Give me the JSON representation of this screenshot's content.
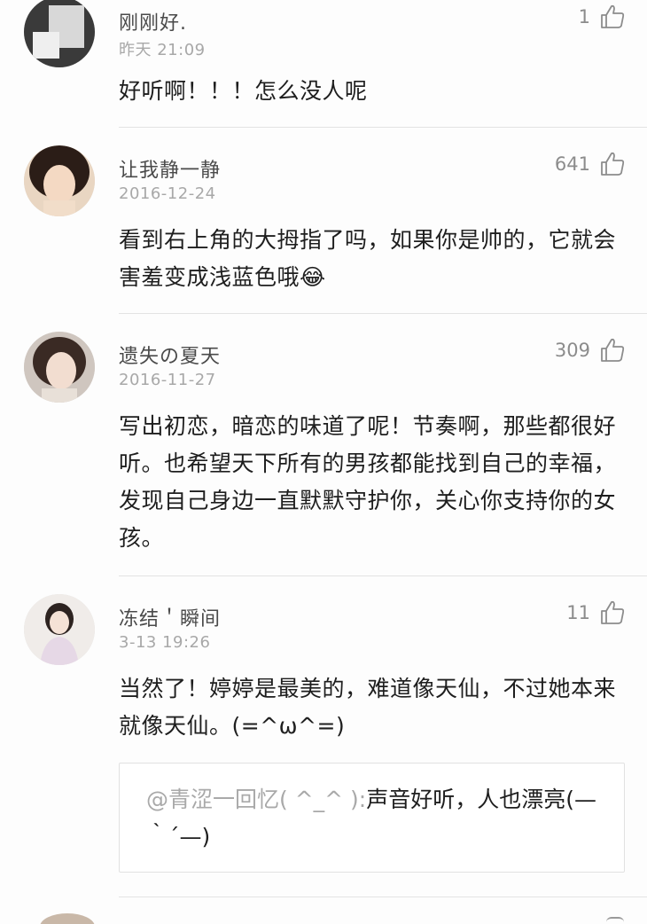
{
  "comments": [
    {
      "username": "刚刚好.",
      "time": "昨天 21:09",
      "likes": "1",
      "text": "好听啊！！！怎么没人呢"
    },
    {
      "username": "让我静一静",
      "time": "2016-12-24",
      "likes": "641",
      "text": "看到右上角的大拇指了吗，如果你是帅的，它就会害羞变成浅蓝色哦😂"
    },
    {
      "username": "遗失の夏天",
      "time": "2016-11-27",
      "likes": "309",
      "text": "写出初恋，暗恋的味道了呢！节奏啊，那些都很好听。也希望天下所有的男孩都能找到自己的幸福，发现自己身边一直默默守护你，关心你支持你的女孩。"
    },
    {
      "username": "冻结＇瞬间",
      "time": "3-13 19:26",
      "likes": "11",
      "text": "当然了！婷婷是最美的，难道像天仙，不过她本来就像天仙。(=^ω^=)",
      "reply": {
        "user": "@青涩一回忆( ^_^ ):",
        "text": "声音好听，人也漂亮(—｀´—)"
      }
    }
  ],
  "icons": {
    "like": "thumbs-up-icon"
  }
}
